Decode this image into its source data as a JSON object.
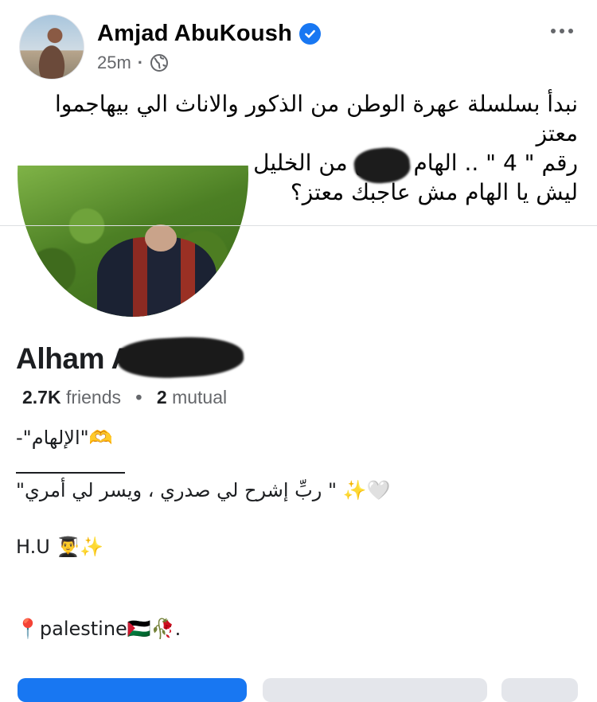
{
  "post": {
    "author_name": "Amjad AbuKoush",
    "verified_icon": "verified-badge-icon",
    "time": "25m",
    "separator": "·",
    "audience_icon": "globe-icon",
    "more_icon": "more-options-icon",
    "caption_lines": [
      "نبدأ بسلسلة عهرة الوطن من الذكور والاناث الي بيهاجموا",
      "معتز",
      "رقم \" 4 \" .. الهام عوض من الخليل",
      "ليش يا الهام مش عاجبك معتز؟"
    ]
  },
  "shared_profile": {
    "name": "Alham Awad",
    "friends_count": "2.7K",
    "friends_label": "friends",
    "separator": "•",
    "mutual_count": "2",
    "mutual_label": "mutual",
    "bio_lines": [
      "-\"الإلهام\"🫶",
      "\"ربِّ إشرح لي صدري ، ويسر لي أمري \" ✨🤍",
      "H.U 👨‍🎓✨",
      "📍palestine🇵🇸🥀."
    ]
  },
  "colors": {
    "accent": "#1877f2",
    "text": "#050505",
    "secondary_text": "#65676b",
    "divider": "#dddfe2"
  }
}
